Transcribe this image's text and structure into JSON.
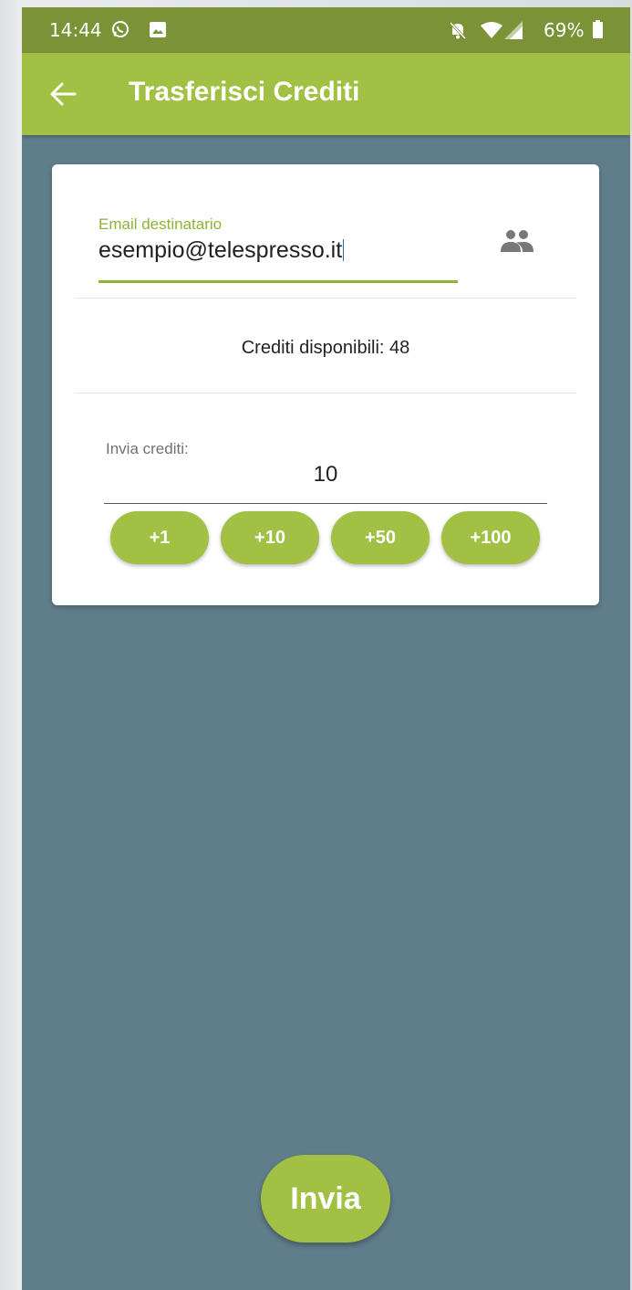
{
  "status_bar": {
    "time": "14:44",
    "battery": "69%",
    "icons": [
      "whatsapp-icon",
      "image-icon",
      "bell-off-icon",
      "wifi-icon",
      "signal-icon",
      "battery-icon"
    ]
  },
  "app_bar": {
    "title": "Trasferisci Crediti",
    "back_icon": "arrow-back-icon"
  },
  "form": {
    "email_label": "Email destinatario",
    "email_value": "esempio@telespresso.it",
    "contacts_icon": "contacts-icon",
    "credits_text": "Crediti disponibili: 48",
    "send_label": "Invia crediti:",
    "send_value": "10",
    "increments": [
      "+1",
      "+10",
      "+50",
      "+100"
    ]
  },
  "submit_label": "Invia",
  "colors": {
    "accent": "#a2c043",
    "status_bar": "#7c9237",
    "background": "#607d8b"
  }
}
